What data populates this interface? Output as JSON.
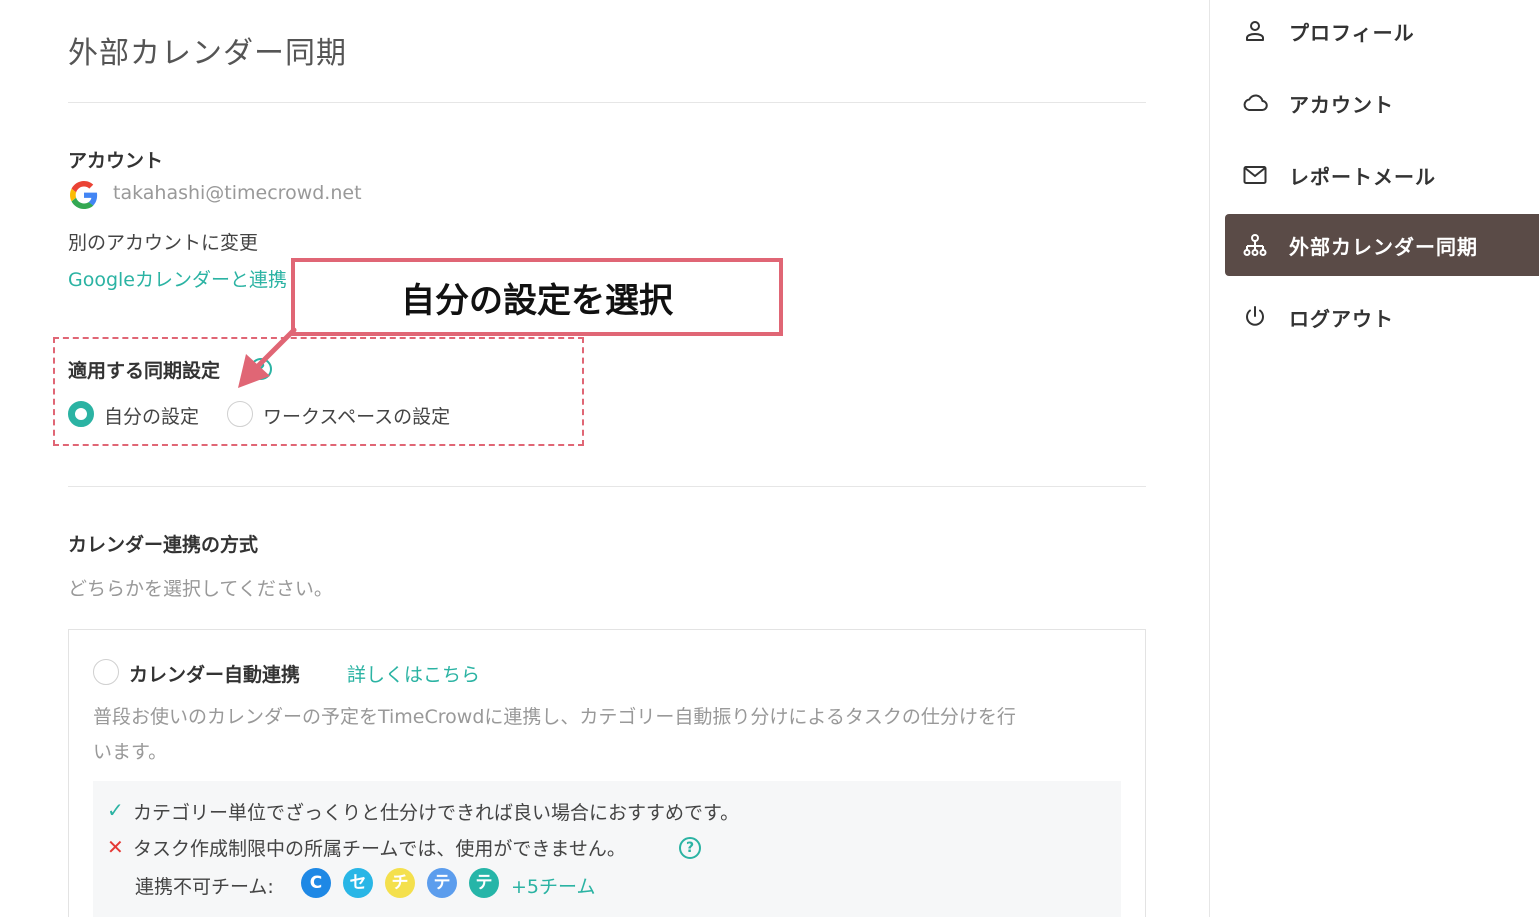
{
  "page": {
    "title": "外部カレンダー同期"
  },
  "account": {
    "label": "アカウント",
    "email": "takahashi@timecrowd.net",
    "change_text": "別のアカウントに変更",
    "link_text": "Googleカレンダーと連携"
  },
  "sync_settings": {
    "label": "適用する同期設定",
    "help": "?",
    "options": [
      {
        "label": "自分の設定",
        "selected": true
      },
      {
        "label": "ワークスペースの設定",
        "selected": false
      }
    ]
  },
  "annotation": {
    "text": "自分の設定を選択"
  },
  "method": {
    "label": "カレンダー連携の方式",
    "hint": "どちらかを選択してください。"
  },
  "auto_sync": {
    "title": "カレンダー自動連携",
    "detail_link": "詳しくはこちら",
    "description_line1": "普段お使いのカレンダーの予定をTimeCrowdに連携し、カテゴリー自動振り分けによるタスクの仕分けを行",
    "description_line2": "います。",
    "pro": "カテゴリー単位でざっくりと仕分けできれば良い場合におすすめです。",
    "con": "タスク作成制限中の所属チームでは、使用ができません。",
    "con_help": "?",
    "unavailable_label": "連携不可チーム:",
    "teams": [
      {
        "initial": "C",
        "color": "#1e88e5"
      },
      {
        "initial": "セ",
        "color": "#29b6e6"
      },
      {
        "initial": "チ",
        "color": "#f4e04d"
      },
      {
        "initial": "テ",
        "color": "#5c9ded"
      },
      {
        "initial": "テ",
        "color": "#26b5a8"
      }
    ],
    "more_teams": "+5チーム"
  },
  "sidebar": {
    "items": [
      {
        "label": "プロフィール",
        "icon": "person-icon",
        "active": false
      },
      {
        "label": "アカウント",
        "icon": "cloud-icon",
        "active": false
      },
      {
        "label": "レポートメール",
        "icon": "mail-icon",
        "active": false
      },
      {
        "label": "外部カレンダー同期",
        "icon": "sitemap-icon",
        "active": true
      },
      {
        "label": "ログアウト",
        "icon": "power-icon",
        "active": false
      }
    ]
  },
  "colors": {
    "accent": "#2bb3a3",
    "annotation": "#e06675",
    "sidebar_active": "#5a4b47",
    "error": "#e53935"
  }
}
